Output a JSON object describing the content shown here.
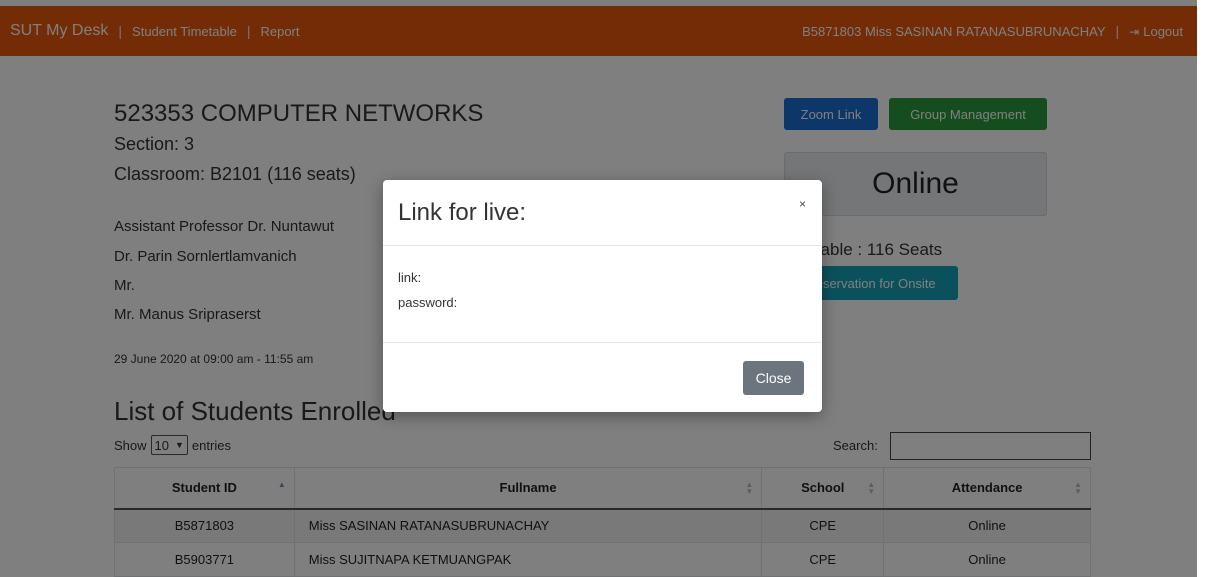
{
  "navbar": {
    "brand": "SUT My Desk",
    "separator": "|",
    "links": [
      "Student Timetable",
      "Report"
    ],
    "user": "B5871803 Miss SASINAN RATANASUBRUNACHAY",
    "logout_label": "Logout"
  },
  "course": {
    "title": "523353 COMPUTER NETWORKS",
    "section": "Section: 3",
    "classroom": "Classroom: B2101 (116 seats)",
    "staff": [
      "Assistant Professor Dr. Nuntawut",
      "Dr. Parin Sornlertlamvanich",
      "Mr.",
      "Mr. Manus Sripraserst"
    ],
    "schedule": "29 June 2020 at 09:00 am - 11:55 am"
  },
  "actions": {
    "zoom_link": "Zoom Link",
    "group_management": "Group Management",
    "mode": "Online",
    "available": "Available : 116 Seats",
    "reservation": "Reservation for Onsite"
  },
  "list": {
    "title": "List of Students Enrolled",
    "show": "Show",
    "entries_value": "10",
    "entries": "entries",
    "search_label": "Search:",
    "search_value": ""
  },
  "table": {
    "headers": [
      "Student ID",
      "Fullname",
      "School",
      "Attendance"
    ],
    "rows": [
      [
        "B5871803",
        "Miss SASINAN RATANASUBRUNACHAY",
        "CPE",
        "Online"
      ],
      [
        "B5903771",
        "Miss SUJITNAPA KETMUANGPAK",
        "CPE",
        "Online"
      ]
    ]
  },
  "modal": {
    "title": "Link for live:",
    "close_x": "×",
    "link_label": "link:",
    "password_label": "password:",
    "close_button": "Close"
  },
  "colors": {
    "navbar": "#e8590c",
    "zoom_button": "#1a6fd1",
    "group_button": "#2b9a3e",
    "reservation_button": "#17a2b8",
    "close_button": "#6c757d"
  }
}
